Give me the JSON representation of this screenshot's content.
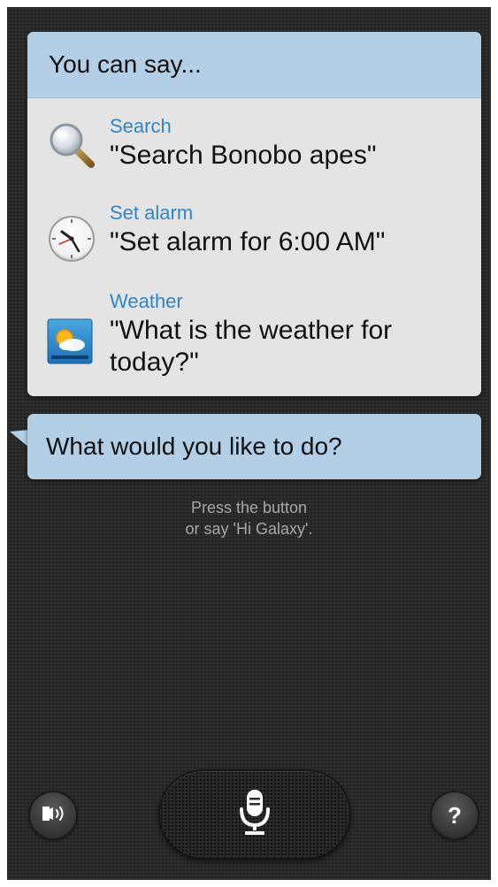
{
  "suggestions": {
    "header": "You can say...",
    "items": [
      {
        "title": "Search",
        "example": "\"Search Bonobo apes\"",
        "icon": "magnifier-icon"
      },
      {
        "title": "Set alarm",
        "example": "\"Set alarm for 6:00 AM\"",
        "icon": "clock-icon"
      },
      {
        "title": "Weather",
        "example": "\"What is the weather for today?\"",
        "icon": "weather-icon"
      }
    ]
  },
  "prompt": {
    "question": "What would you like to do?",
    "hint_line1": "Press the button",
    "hint_line2": "or say 'Hi Galaxy'."
  },
  "controls": {
    "left_icon": "speaker-output-icon",
    "center_icon": "microphone-icon",
    "right_label": "?"
  },
  "colors": {
    "accent_blue": "#2e86c9",
    "bubble_bg": "#b3cfe5",
    "card_bg": "#e4e4e4",
    "screen_bg": "#2a2a2a"
  }
}
